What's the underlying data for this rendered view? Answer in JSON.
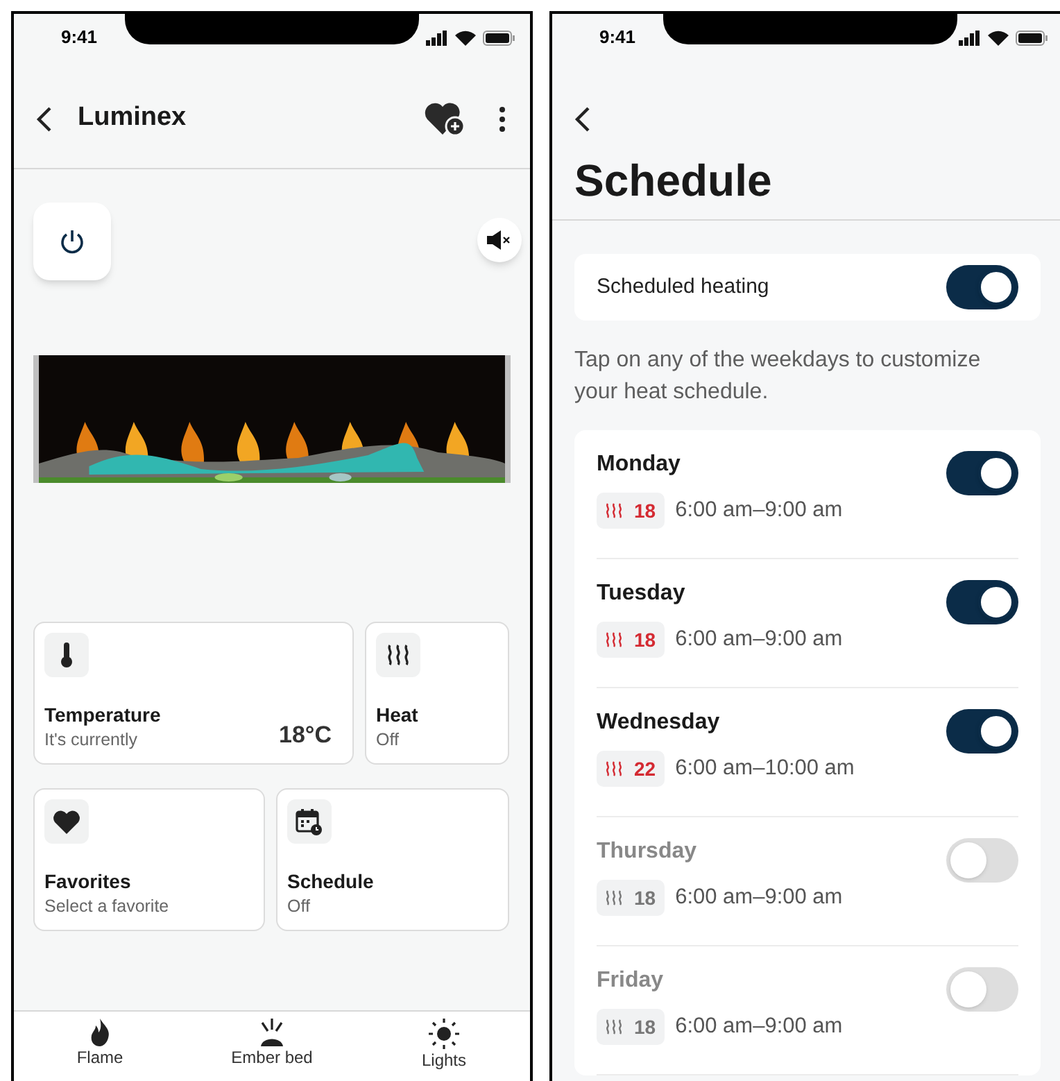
{
  "device_screen": {
    "status_bar": {
      "time": "9:41"
    },
    "header": {
      "title": "Luminex"
    },
    "tiles": [
      {
        "title": "Temperature",
        "subtitle": "It's currently",
        "value": "18°C"
      },
      {
        "title": "Heat",
        "subtitle": "Off"
      },
      {
        "title": "Favorites",
        "subtitle": "Select a favorite"
      },
      {
        "title": "Schedule",
        "subtitle": "Off"
      }
    ],
    "bottom_nav": [
      {
        "label": "Flame"
      },
      {
        "label": "Ember bed"
      },
      {
        "label": "Lights"
      }
    ]
  },
  "schedule_screen": {
    "status_bar": {
      "time": "9:41"
    },
    "title": "Schedule",
    "scheduled_heating": {
      "label": "Scheduled heating",
      "on": true
    },
    "description": "Tap on any of the weekdays to customize your heat schedule.",
    "days": [
      {
        "name": "Monday",
        "on": true,
        "temperature": "18",
        "time": "6:00 am–9:00 am"
      },
      {
        "name": "Tuesday",
        "on": true,
        "temperature": "18",
        "time": "6:00 am–9:00 am"
      },
      {
        "name": "Wednesday",
        "on": true,
        "temperature": "22",
        "time": "6:00 am–10:00 am"
      },
      {
        "name": "Thursday",
        "on": false,
        "temperature": "18",
        "time": "6:00 am–9:00 am"
      },
      {
        "name": "Friday",
        "on": false,
        "temperature": "18",
        "time": "6:00 am–9:00 am"
      }
    ]
  }
}
